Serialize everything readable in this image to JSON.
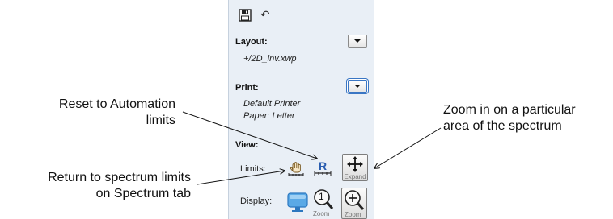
{
  "panel": {
    "layout": {
      "label": "Layout:",
      "value": "+/2D_inv.xwp"
    },
    "print": {
      "label": "Print:",
      "printer": "Default Printer",
      "paper": "Paper: Letter"
    },
    "view": {
      "label": "View:",
      "limits_label": "Limits:",
      "reset_letter": "R",
      "expand_caption": "Expand",
      "display_label": "Display:",
      "zoom_caption_1": "Zoom",
      "zoom_caption_2": "Zoom",
      "zoom_one": "1"
    }
  },
  "annotations": {
    "reset_line1": "Reset to Automation",
    "reset_line2": "limits",
    "return_line1": "Return to spectrum limits",
    "return_line2": "on Spectrum tab",
    "zoom_line1": "Zoom in on a particular",
    "zoom_line2": "area of the spectrum"
  },
  "colors": {
    "panel_bg": "#e9eff6",
    "accent_blue": "#2a5db0",
    "focus_ring": "#3a76c4"
  },
  "icons": [
    "save-icon",
    "undo-icon",
    "hand-icon",
    "reset-r-icon",
    "expand-icon",
    "monitor-icon",
    "zoom-one-icon",
    "zoom-in-icon"
  ]
}
